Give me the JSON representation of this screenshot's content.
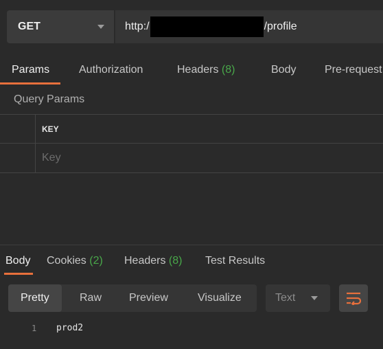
{
  "request": {
    "method": "GET",
    "url_prefix": "http:/",
    "url_suffix": "/profile"
  },
  "request_tabs": [
    {
      "label": "Params"
    },
    {
      "label": "Authorization"
    },
    {
      "label": "Headers ",
      "count": "(8)"
    },
    {
      "label": "Body"
    },
    {
      "label": "Pre-request"
    }
  ],
  "params": {
    "section_label": "Query Params",
    "column_key": "KEY",
    "key_placeholder": "Key"
  },
  "response_tabs": [
    {
      "label": "Body"
    },
    {
      "label": "Cookies ",
      "count": "(2)"
    },
    {
      "label": "Headers ",
      "count": "(8)"
    },
    {
      "label": "Test Results"
    }
  ],
  "format": {
    "options": [
      "Pretty",
      "Raw",
      "Preview",
      "Visualize"
    ],
    "selected": "Pretty",
    "type_select": "Text",
    "wrap_icon": "wrap-lines-icon"
  },
  "response_body": {
    "lines": [
      {
        "number": "1",
        "text": "prod2"
      }
    ]
  },
  "colors": {
    "accent": "#e8703c",
    "count": "#49a84a",
    "background": "#2a2a2a"
  }
}
